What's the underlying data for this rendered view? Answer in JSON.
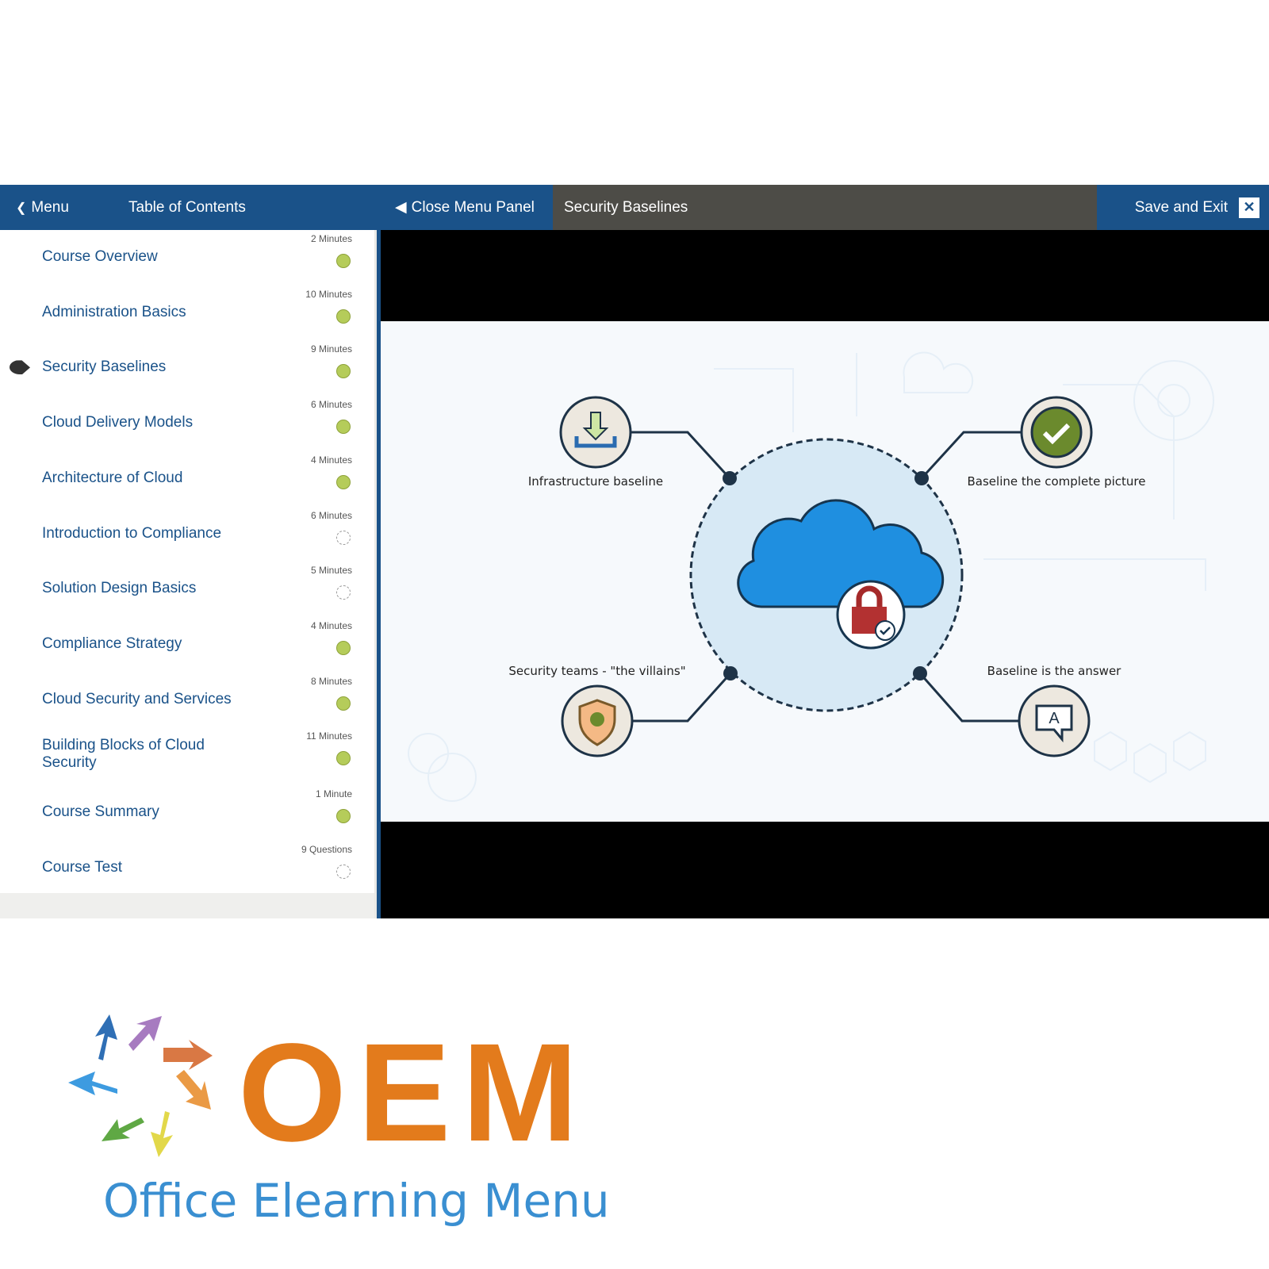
{
  "header": {
    "menu_label": "Menu",
    "toc_label": "Table of Contents",
    "close_panel_label": "Close Menu Panel",
    "current_title": "Security Baselines",
    "save_exit_label": "Save and Exit",
    "close_icon": "✕"
  },
  "toc": [
    {
      "title": "Course Overview",
      "duration": "2 Minutes",
      "complete": true
    },
    {
      "title": "Administration Basics",
      "duration": "10 Minutes",
      "complete": true
    },
    {
      "title": "Security Baselines",
      "duration": "9 Minutes",
      "complete": true,
      "current": true
    },
    {
      "title": "Cloud Delivery Models",
      "duration": "6 Minutes",
      "complete": true
    },
    {
      "title": "Architecture of Cloud",
      "duration": "4 Minutes",
      "complete": true
    },
    {
      "title": "Introduction to Compliance",
      "duration": "6 Minutes",
      "complete": false
    },
    {
      "title": "Solution Design Basics",
      "duration": "5 Minutes",
      "complete": false
    },
    {
      "title": "Compliance Strategy",
      "duration": "4 Minutes",
      "complete": true
    },
    {
      "title": "Cloud Security and Services",
      "duration": "8 Minutes",
      "complete": true
    },
    {
      "title": "Building Blocks of Cloud Security",
      "duration": "11 Minutes",
      "complete": true
    },
    {
      "title": "Course Summary",
      "duration": "1 Minute",
      "complete": true
    },
    {
      "title": "Course Test",
      "duration": "9 Questions",
      "complete": false
    }
  ],
  "slide": {
    "labels": {
      "tl": "Infrastructure baseline",
      "tr": "Baseline the complete picture",
      "bl": "Security teams - \"the villains\"",
      "br": "Baseline is the answer"
    },
    "bubble_letter": "A"
  },
  "brand": {
    "logo_text": "OEM",
    "tagline": "Office Elearning Menu",
    "orange": "#e37b1c",
    "blue": "#3a8fd1"
  },
  "colors": {
    "header_blue": "#1a5289",
    "header_gray": "#4d4c47",
    "complete_dot": "#b5cc5a"
  }
}
